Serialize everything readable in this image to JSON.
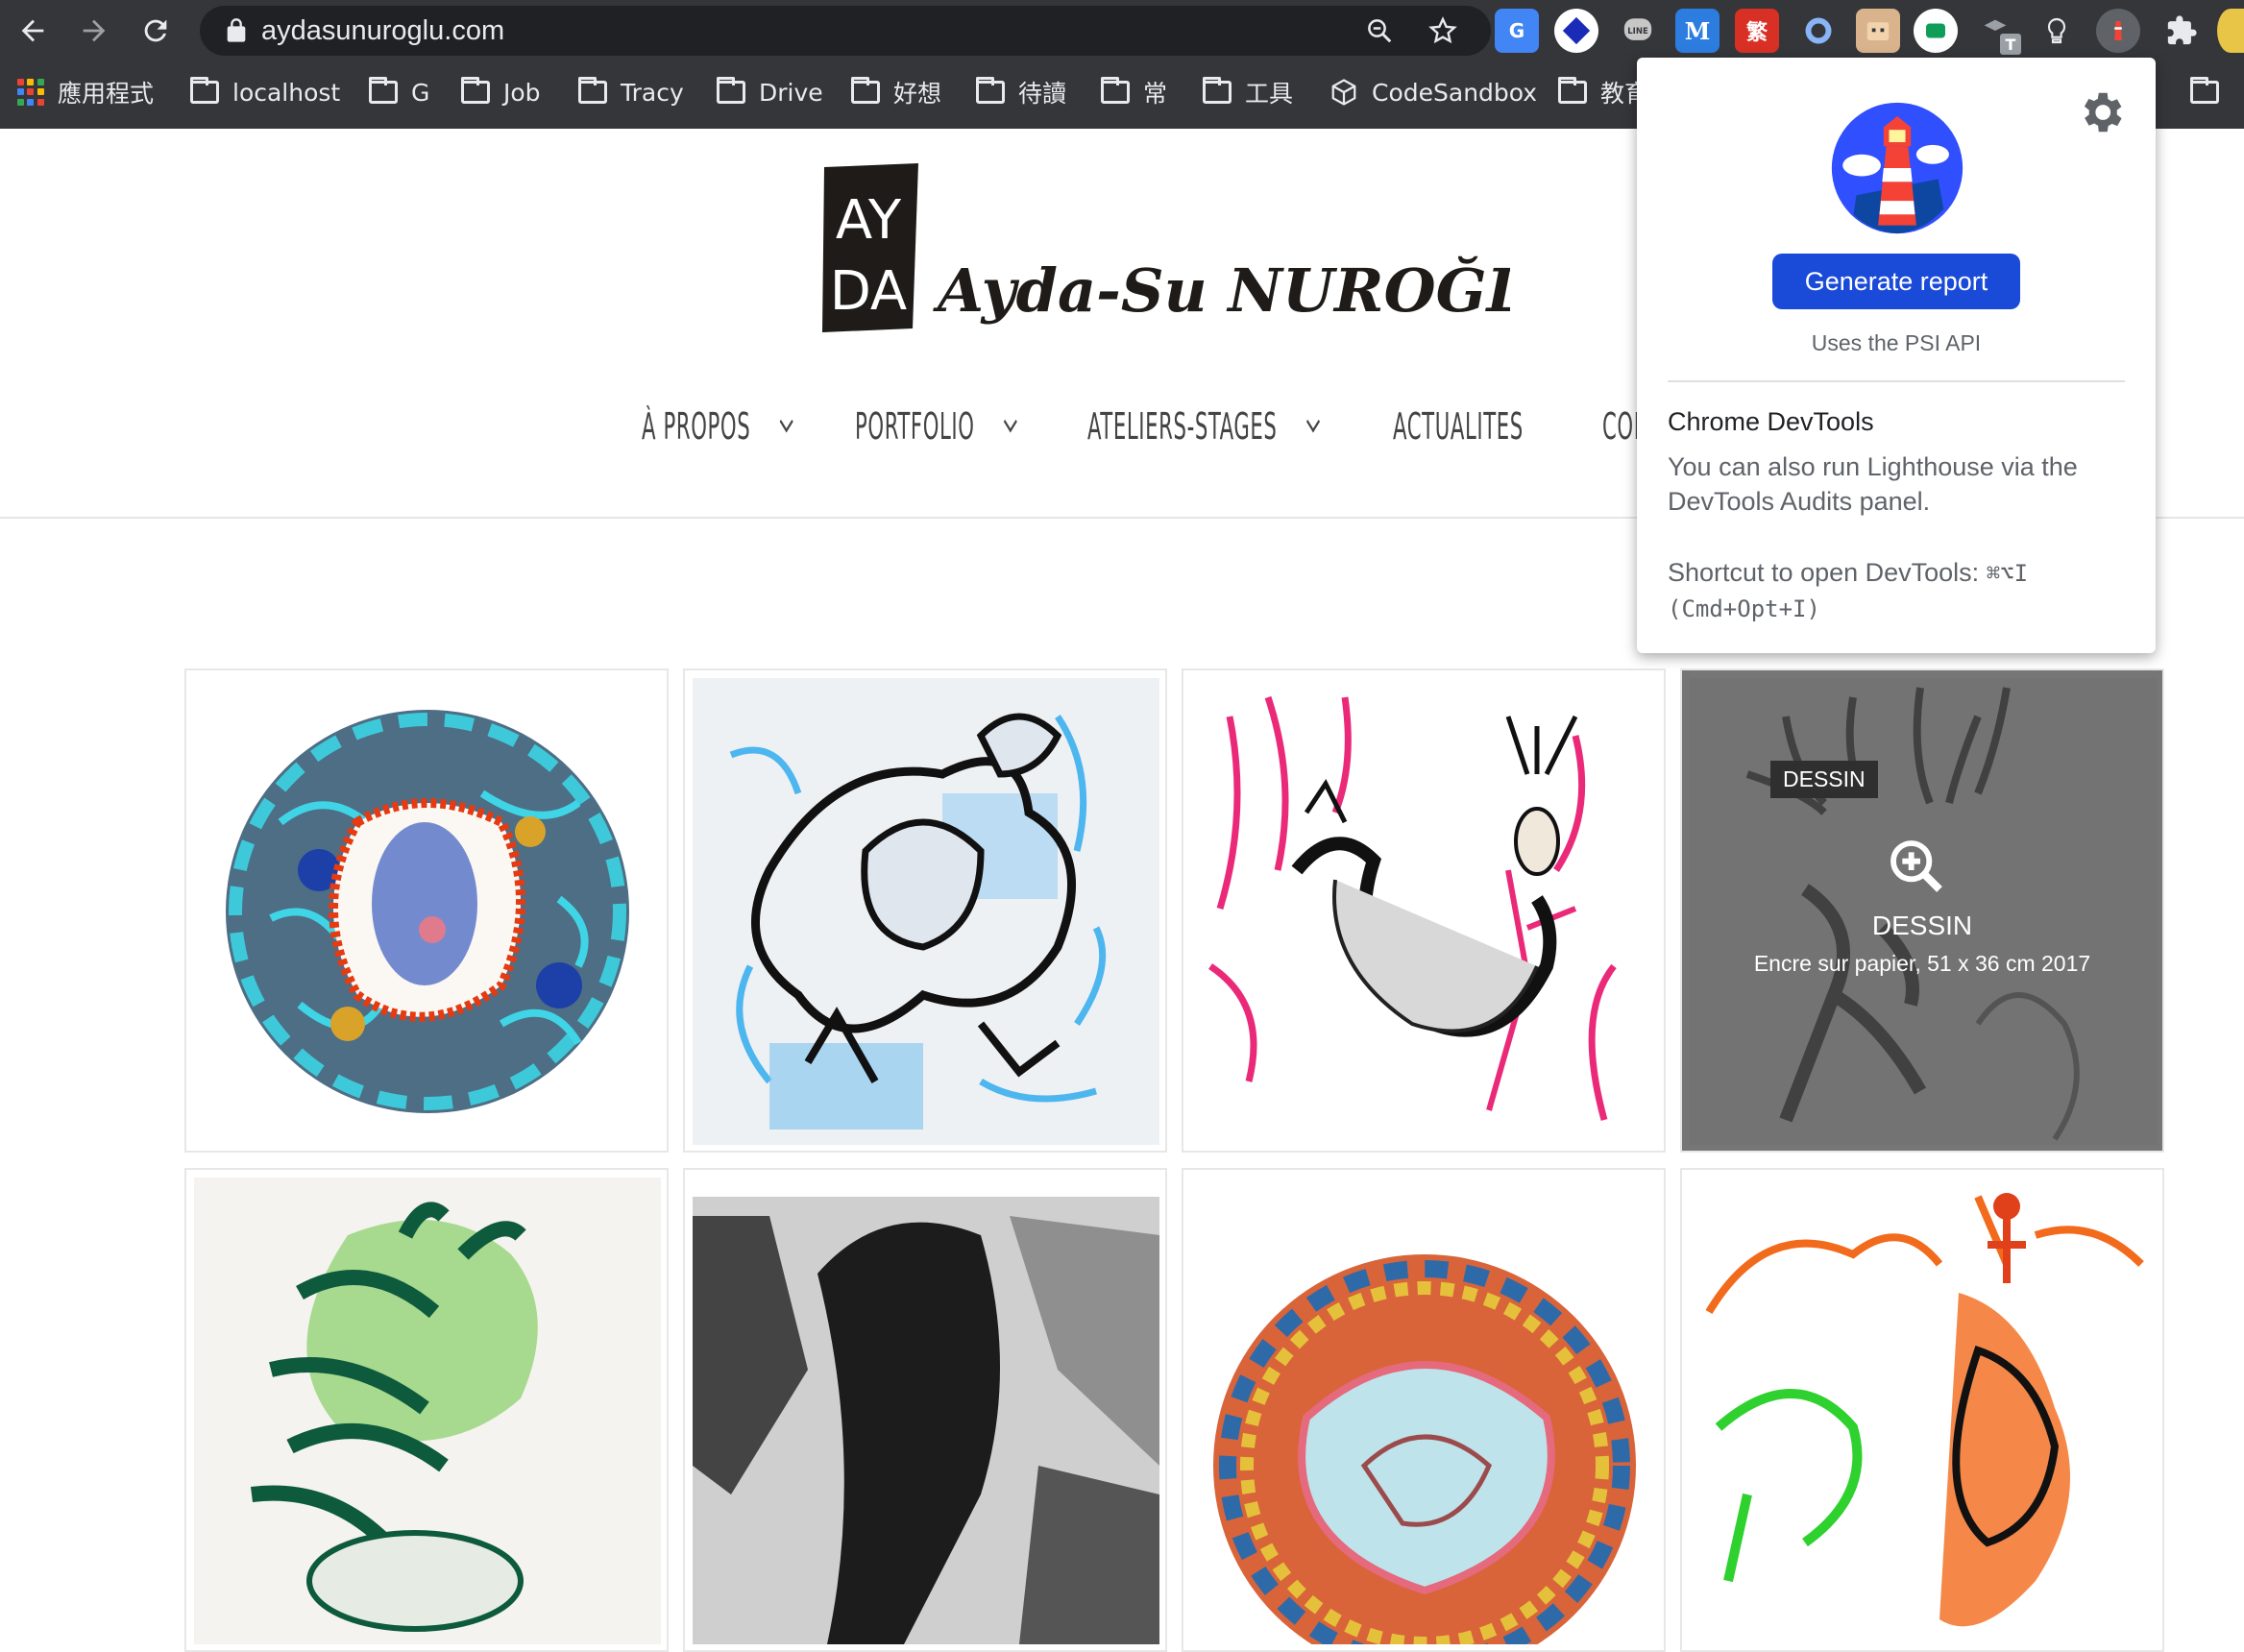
{
  "browser": {
    "url": "aydasunuroglu.com",
    "bookmarks": [
      {
        "label": "應用程式",
        "kind": "apps"
      },
      {
        "label": "localhost",
        "kind": "folder"
      },
      {
        "label": "G",
        "kind": "folder"
      },
      {
        "label": "Job",
        "kind": "folder"
      },
      {
        "label": "Tracy",
        "kind": "folder"
      },
      {
        "label": "Drive",
        "kind": "folder"
      },
      {
        "label": "好想",
        "kind": "folder"
      },
      {
        "label": "待讀",
        "kind": "folder"
      },
      {
        "label": "常",
        "kind": "folder"
      },
      {
        "label": "工具",
        "kind": "folder"
      },
      {
        "label": "CodeSandbox",
        "kind": "cube"
      },
      {
        "label": "教育",
        "kind": "folder"
      }
    ],
    "extension_badge_t": "T",
    "ext_fan_label": "繁",
    "ext_m_label": "M"
  },
  "site": {
    "logo_text": "Ayda-Su NUROĞLU",
    "logo_mark_top": "AY",
    "logo_mark_bottom": "DA",
    "nav": [
      {
        "label": "À PROPOS",
        "has_menu": true
      },
      {
        "label": "PORTFOLIO",
        "has_menu": true
      },
      {
        "label": "ATELIERS-STAGES",
        "has_menu": true
      },
      {
        "label": "ACTUALITES",
        "has_menu": false
      },
      {
        "label": "CONTACT",
        "has_menu": false
      }
    ],
    "hover_tile": {
      "tag": "DESSIN",
      "title": "DESSIN",
      "subtitle": "Encre sur papier, 51 x 36 cm 2017"
    }
  },
  "lighthouse_popup": {
    "button": "Generate report",
    "note": "Uses the PSI API",
    "heading": "Chrome DevTools",
    "paragraph": "You can also run Lighthouse via the DevTools Audits panel.",
    "shortcut_prefix": "Shortcut to open DevTools:",
    "shortcut_keys": "⌘⌥I",
    "shortcut_alt": "(Cmd+Opt+I)"
  },
  "colors": {
    "browser_bg": "#35363a",
    "omnibox": "#202124",
    "primary_button": "#1a4ad8"
  }
}
